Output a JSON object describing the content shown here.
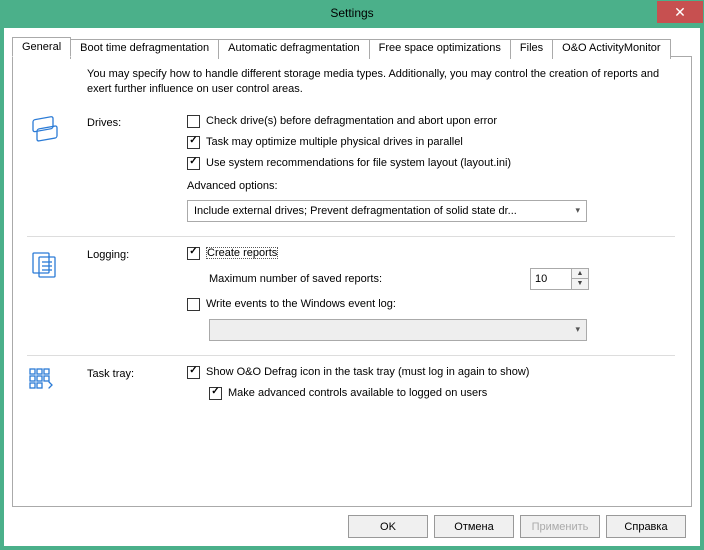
{
  "window": {
    "title": "Settings"
  },
  "tabs": [
    {
      "label": "General"
    },
    {
      "label": "Boot time defragmentation"
    },
    {
      "label": "Automatic defragmentation"
    },
    {
      "label": "Free space optimizations"
    },
    {
      "label": "Files"
    },
    {
      "label": "O&O ActivityMonitor"
    }
  ],
  "intro": "You may specify how to handle different storage media types. Additionally, you may control the creation of reports and exert further influence on user control areas.",
  "drives": {
    "label": "Drives:",
    "check_before": "Check drive(s) before defragmentation and abort upon error",
    "parallel": "Task may optimize multiple physical drives in parallel",
    "layout": "Use system recommendations for file system layout (layout.ini)",
    "adv_label": "Advanced options:",
    "adv_value": "Include external drives; Prevent defragmentation of solid state dr..."
  },
  "logging": {
    "label": "Logging:",
    "create": "Create reports",
    "max_label": "Maximum number of saved reports:",
    "max_value": "10",
    "eventlog": "Write events to the Windows event log:"
  },
  "tray": {
    "label": "Task tray:",
    "show": "Show O&O Defrag icon in the task tray (must log in again to show)",
    "adv": "Make advanced controls available to logged on users"
  },
  "buttons": {
    "ok": "OK",
    "cancel": "Отмена",
    "apply": "Применить",
    "help": "Справка"
  }
}
